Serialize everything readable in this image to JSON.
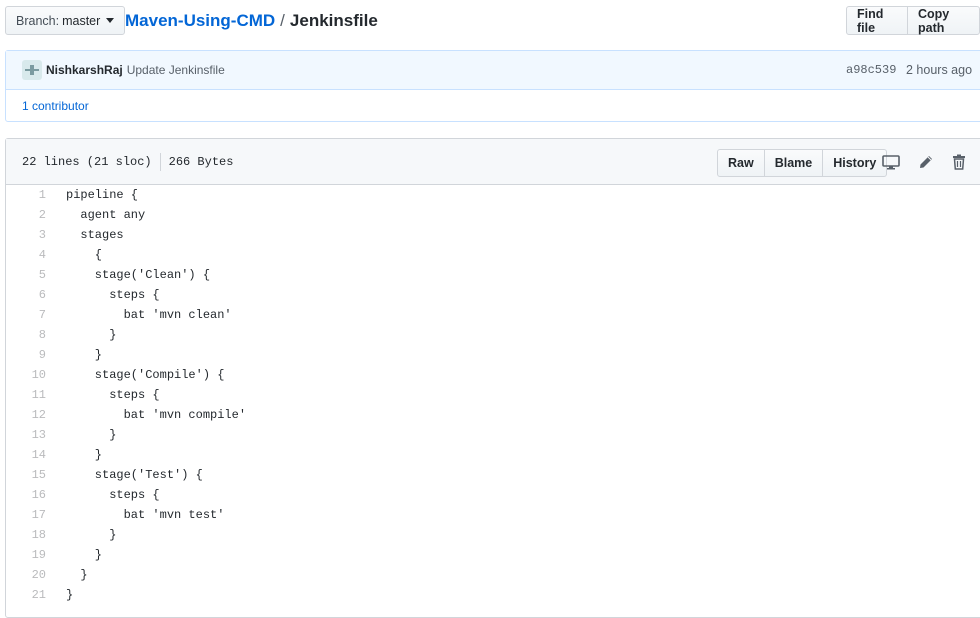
{
  "branch": {
    "prefix": "Branch:",
    "name": "master"
  },
  "breadcrumb": {
    "repo": "Maven-Using-CMD",
    "separator": "/",
    "file": "Jenkinsfile"
  },
  "top_actions": {
    "find_file": "Find file",
    "copy_path": "Copy path"
  },
  "commit": {
    "author": "NishkarshRaj",
    "message": "Update Jenkinsfile",
    "sha": "a98c539",
    "time": "2 hours ago",
    "contributors": "1 contributor"
  },
  "file": {
    "lines_info": "22 lines (21 sloc)",
    "size": "266 Bytes",
    "actions": {
      "raw": "Raw",
      "blame": "Blame",
      "history": "History"
    },
    "icons": [
      "desktop-icon",
      "pencil-icon",
      "trash-icon"
    ],
    "code": [
      "pipeline {",
      "  agent any",
      "  stages",
      "    {",
      "    stage('Clean') {",
      "      steps {",
      "        bat 'mvn clean'",
      "      }",
      "    }",
      "    stage('Compile') {",
      "      steps {",
      "        bat 'mvn compile'",
      "      }",
      "    }",
      "    stage('Test') {",
      "      steps {",
      "        bat 'mvn test'",
      "      }",
      "    }",
      "  }",
      "}"
    ]
  },
  "colors": {
    "link": "#0366d6",
    "commit_bg": "#f1f8ff",
    "header_bg": "#f6f8fa"
  }
}
